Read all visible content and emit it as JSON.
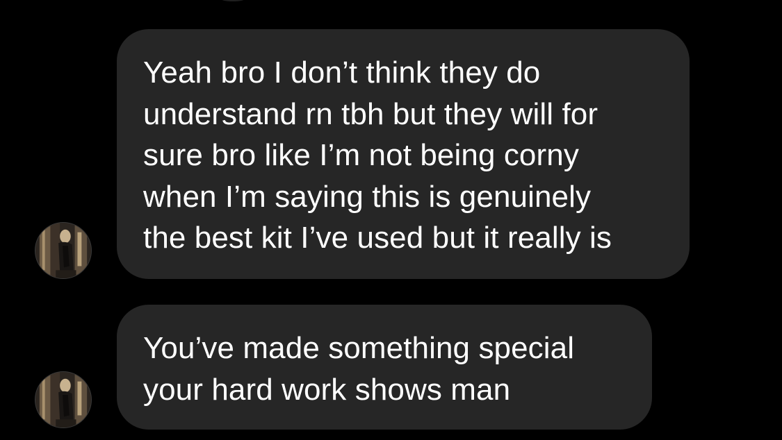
{
  "thread": {
    "messages": [
      {
        "sender": "other",
        "text": "Yeah bro I don’t think they do\nunderstand rn tbh but they will for\nsure bro like I’m not being corny\nwhen I’m saying this is genuinely\nthe best kit I’ve used but it really is",
        "avatar_icon": "profile-avatar"
      },
      {
        "sender": "other",
        "text": "You’ve made something special\nyour hard work shows man",
        "avatar_icon": "profile-avatar"
      }
    ]
  },
  "colors": {
    "background": "#000000",
    "bubble": "#262626",
    "text": "#ffffff"
  }
}
